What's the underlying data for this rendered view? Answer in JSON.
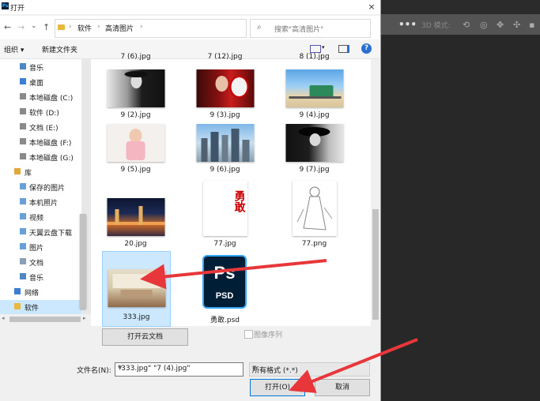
{
  "dialog": {
    "title": "打开",
    "close": "×",
    "nav": {
      "back": "←",
      "forward": "→",
      "recent": "⌄",
      "up": "↑"
    },
    "breadcrumb": [
      "软件",
      "高清图片"
    ],
    "search_placeholder": "搜索\"高清图片\"",
    "toolbar": {
      "organize": "组织 ▾",
      "new_folder": "新建文件夹",
      "help": "?"
    },
    "nav_items": [
      {
        "label": "音乐"
      },
      {
        "label": "桌面"
      },
      {
        "label": "本地磁盘 (C:)"
      },
      {
        "label": "软件 (D:)"
      },
      {
        "label": "文档 (E:)"
      },
      {
        "label": "本地磁盘 (F:)"
      },
      {
        "label": "本地磁盘 (G:)"
      },
      {
        "label": "库"
      },
      {
        "label": "保存的图片"
      },
      {
        "label": "本机照片"
      },
      {
        "label": "视频"
      },
      {
        "label": "天翼云盘下载"
      },
      {
        "label": "图片"
      },
      {
        "label": "文档"
      },
      {
        "label": "音乐"
      },
      {
        "label": "网络"
      },
      {
        "label": "软件"
      }
    ],
    "files": [
      {
        "name": "7 (6).jpg"
      },
      {
        "name": "7 (12).jpg"
      },
      {
        "name": "8 (1).jpg"
      },
      {
        "name": "9 (2).jpg"
      },
      {
        "name": "9 (3).jpg"
      },
      {
        "name": "9 (4).jpg"
      },
      {
        "name": "9 (5).jpg"
      },
      {
        "name": "9 (6).jpg"
      },
      {
        "name": "9 (7).jpg"
      },
      {
        "name": "20.jpg"
      },
      {
        "name": "77.jpg"
      },
      {
        "name": "77.png"
      },
      {
        "name": "333.jpg"
      },
      {
        "name": "勇敢.psd"
      }
    ],
    "thumb_77_text": "勇敢",
    "psd_icon": {
      "ps": "Ps",
      "psd": "PSD"
    },
    "open_cloud_button": "打开云文档",
    "image_sequence_label": "图像序列",
    "filename_label": "文件名(N):",
    "filename_value": "\"333.jpg\" \"7 (4).jpg\"",
    "filter_value": "所有格式 (*.*)",
    "open_button": "打开(O)",
    "cancel_button": "取消"
  },
  "photoshop": {
    "more": "•••",
    "mode_label": "3D 模式:"
  }
}
